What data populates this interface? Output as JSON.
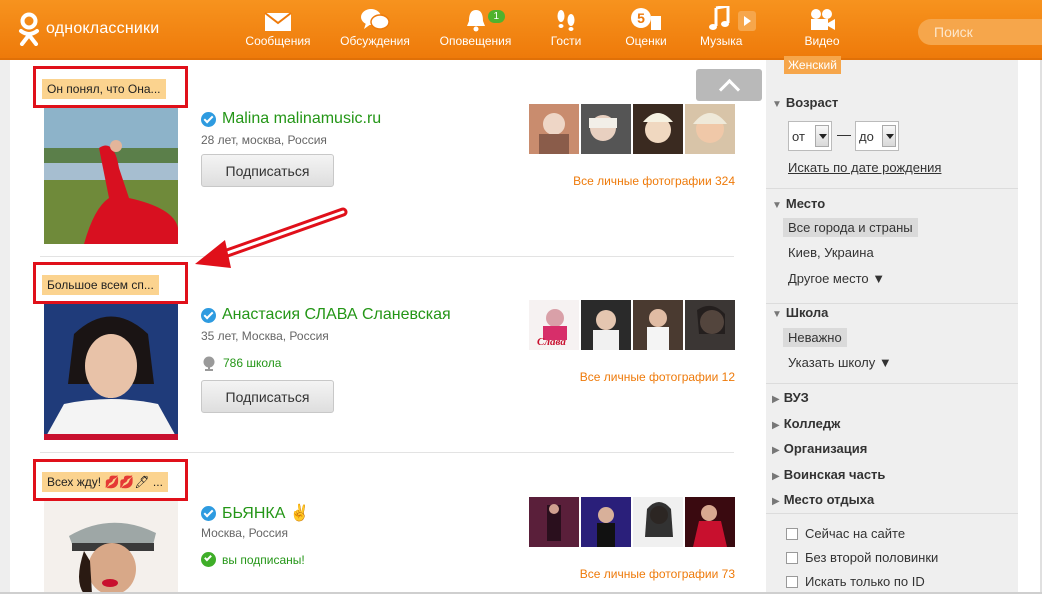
{
  "header": {
    "logo_text": "одноклассники",
    "nav": [
      {
        "label": "Сообщения",
        "icon": "envelope-icon"
      },
      {
        "label": "Обсуждения",
        "icon": "chat-bubbles-icon"
      },
      {
        "label": "Оповещения",
        "icon": "bell-icon",
        "badge": "1"
      },
      {
        "label": "Гости",
        "icon": "footprints-icon"
      },
      {
        "label": "Оценки",
        "icon": "rating-5-icon"
      },
      {
        "label": "Музыка",
        "icon": "music-note-icon"
      },
      {
        "label": "Видео",
        "icon": "video-camera-icon"
      }
    ],
    "search_placeholder": "Поиск"
  },
  "results": [
    {
      "status": "Он понял, что Она...",
      "name": "Malina malinamusic.ru",
      "meta": "28 лет, москва, Россия",
      "extra": "",
      "button": "Подписаться",
      "all_photos": "Все личные фотографии 324"
    },
    {
      "status": "Большое всем сп...",
      "name": "Анастасия СЛАВА Сланевская",
      "meta": "35 лет, Москва, Россия",
      "extra": "786 школа",
      "button": "Подписаться",
      "all_photos": "Все личные фотографии 12",
      "thumb_label": "Слава"
    },
    {
      "status": "Всех жду! 💋💋🖊 ...",
      "name": "БЬЯНКА ✌",
      "meta": "Москва, Россия",
      "extra": "вы подписаны!",
      "button": "",
      "all_photos": "Все личные фотографии 73"
    }
  ],
  "sidebar": {
    "gender_selected": "Женский",
    "age": {
      "title": "Возраст",
      "from": "от",
      "to": "до",
      "birth_link": "Искать по дате рождения"
    },
    "place": {
      "title": "Место",
      "options": [
        "Все города и страны",
        "Киев, Украина",
        "Другое место ▼"
      ]
    },
    "school": {
      "title": "Школа",
      "options": [
        "Неважно",
        "Указать школу ▼"
      ]
    },
    "collapsed": [
      "ВУЗ",
      "Колледж",
      "Организация",
      "Воинская часть",
      "Место отдыха"
    ],
    "checkboxes": [
      "Сейчас на сайте",
      "Без второй половинки",
      "Искать только по ID"
    ]
  },
  "colors": {
    "brand_orange": "#ee7a0a",
    "link_green": "#249617",
    "highlight_red": "#e0101a"
  }
}
